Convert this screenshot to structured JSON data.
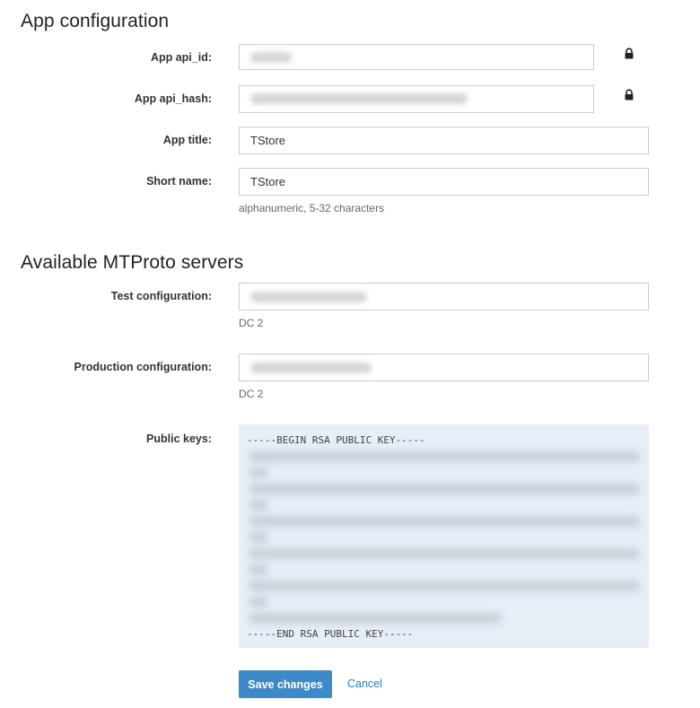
{
  "app_config": {
    "heading": "App configuration",
    "api_id": {
      "label": "App api_id:",
      "value": ""
    },
    "api_hash": {
      "label": "App api_hash:",
      "value": ""
    },
    "title": {
      "label": "App title:",
      "value": "TStore"
    },
    "short_name": {
      "label": "Short name:",
      "value": "TStore",
      "hint": "alphanumeric, 5-32 characters"
    }
  },
  "servers": {
    "heading": "Available MTProto servers",
    "test": {
      "label": "Test configuration:",
      "value": "",
      "dc": "DC 2"
    },
    "production": {
      "label": "Production configuration:",
      "value": "",
      "dc": "DC 2"
    },
    "public_keys": {
      "label": "Public keys:",
      "begin": "-----BEGIN RSA PUBLIC KEY-----",
      "end": "-----END RSA PUBLIC KEY-----"
    }
  },
  "actions": {
    "save_label": "Save changes",
    "cancel_label": "Cancel"
  },
  "icons": {
    "lock": "lock-icon"
  },
  "colors": {
    "primary": "#3d8ac8",
    "link": "#2a7fc0",
    "keys_bg": "#e6eef6"
  }
}
